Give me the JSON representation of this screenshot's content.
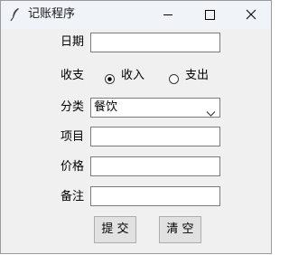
{
  "window": {
    "title": "记账程序",
    "icon": "feather-icon",
    "controls": {
      "minimize": "minimize-icon",
      "maximize": "maximize-icon",
      "close": "close-icon"
    }
  },
  "form": {
    "date_label": "日期",
    "date_value": "",
    "type_label": "收支",
    "type_options": [
      "收入",
      "支出"
    ],
    "type_selected": "收入",
    "category_label": "分类",
    "category_value": "餐饮",
    "item_label": "项目",
    "item_value": "",
    "price_label": "价格",
    "price_value": "",
    "note_label": "备注",
    "note_value": ""
  },
  "buttons": {
    "submit_label": "提 交",
    "clear_label": "清 空"
  }
}
